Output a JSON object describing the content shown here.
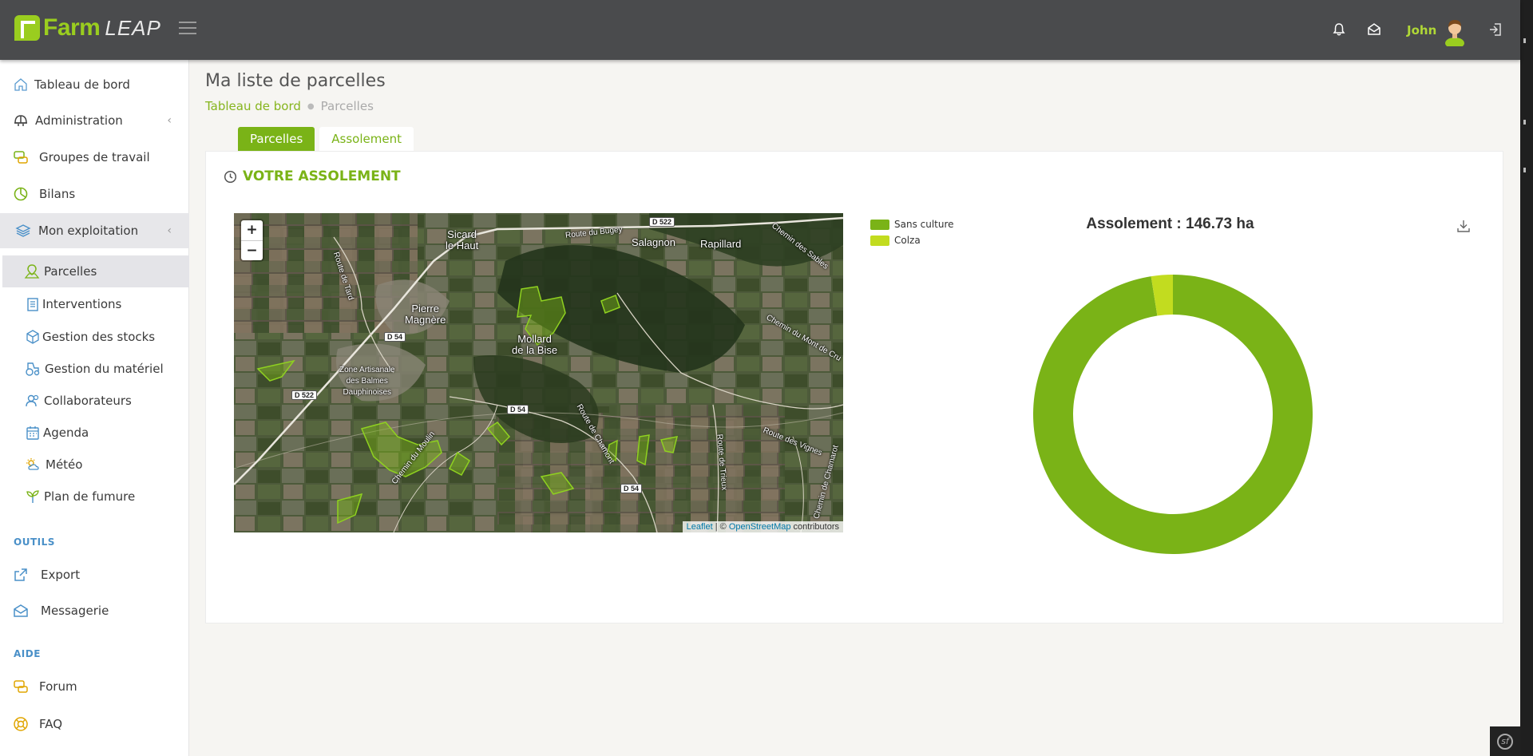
{
  "header": {
    "logo_farm": "Farm",
    "logo_leap": "LEAP",
    "user_name": "John"
  },
  "sidebar": {
    "items": [
      {
        "label": "Tableau de bord",
        "icon": "home-icon"
      },
      {
        "label": "Administration",
        "icon": "helmet-icon"
      },
      {
        "label": "Groupes de travail",
        "icon": "chat-icon"
      },
      {
        "label": "Bilans",
        "icon": "pie-icon"
      },
      {
        "label": "Mon exploitation",
        "icon": "layers-icon"
      }
    ],
    "subitems": [
      {
        "label": "Parcelles",
        "icon": "map-pin-icon"
      },
      {
        "label": "Interventions",
        "icon": "clipboard-icon"
      },
      {
        "label": "Gestion des stocks",
        "icon": "box-icon"
      },
      {
        "label": "Gestion du matériel",
        "icon": "tractor-icon"
      },
      {
        "label": "Collaborateurs",
        "icon": "users-icon"
      },
      {
        "label": "Agenda",
        "icon": "calendar-icon"
      },
      {
        "label": "Météo",
        "icon": "weather-icon"
      },
      {
        "label": "Plan de fumure",
        "icon": "plant-icon"
      }
    ],
    "section_outils": "OUTILS",
    "outils": [
      {
        "label": "Export",
        "icon": "export-icon"
      },
      {
        "label": "Messagerie",
        "icon": "mail-icon"
      }
    ],
    "section_aide": "AIDE",
    "aide": [
      {
        "label": "Forum",
        "icon": "forum-icon"
      },
      {
        "label": "FAQ",
        "icon": "lifebuoy-icon"
      }
    ]
  },
  "main": {
    "page_title": "Ma liste de parcelles",
    "breadcrumb": {
      "home": "Tableau de bord",
      "current": "Parcelles"
    },
    "tabs": [
      {
        "label": "Parcelles",
        "active": true
      },
      {
        "label": "Assolement",
        "active": false
      }
    ],
    "panel_title": "VOTRE ASSOLEMENT",
    "map": {
      "zoom_in": "+",
      "zoom_out": "−",
      "attribution_leaflet": "Leaflet",
      "attribution_sep": " | © ",
      "attribution_osm": "OpenStreetMap",
      "attribution_tail": " contributors",
      "places": {
        "sicard": "Sicard\nle Haut",
        "salagnon": "Salagnon",
        "rapillard": "Rapillard",
        "pierre": "Pierre\nMagnère",
        "mollard": "Mollard\nde la Bise",
        "zone": "Zone Artisanale\ndes Balmes\nDauphinoises",
        "route_bugey": "Route du Bugey",
        "route_tard": "Route de Tard",
        "chemin_sables": "Chemin des Sables",
        "chemin_mont": "Chemin du Mont de Cru",
        "route_chamont": "Route de Chamont",
        "route_vignes": "Route des Vignes",
        "route_trieux": "Route de Trieux",
        "chemin_moulin": "Chemin du Moulin",
        "chemin_chamarot": "Chemin de Chamarot"
      },
      "road_tags": {
        "d522_top": "D 522",
        "d54_a": "D 54",
        "d522_left": "D 522",
        "d54_b": "D 54",
        "d54_c": "D 54"
      }
    },
    "legend": [
      {
        "label": "Sans culture",
        "color": "#7ab317"
      },
      {
        "label": "Colza",
        "color": "#c2dc1f"
      }
    ],
    "chart_title": "Assolement : 146.73 ha"
  },
  "chart_data": {
    "type": "pie",
    "title": "Assolement : 146.73 ha",
    "categories": [
      "Sans culture",
      "Colza"
    ],
    "values": [
      97.5,
      2.5
    ],
    "colors": [
      "#7ab317",
      "#c2dc1f"
    ],
    "donut": true,
    "legend": "top-left"
  }
}
